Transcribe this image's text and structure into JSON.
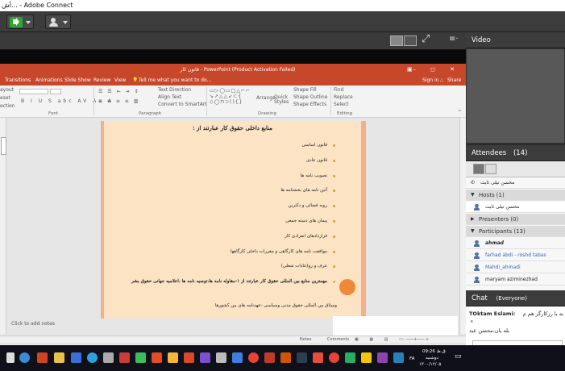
{
  "window": {
    "title": "أش... - Adobe Connect"
  },
  "toolbar": {
    "speaker_icon": "speaker-icon",
    "camera_icon": "camera-icon"
  },
  "share_pod": {
    "fullscreen_icon": "fullscreen-icon",
    "menu_glyph": "≡·"
  },
  "powerpoint": {
    "doc_title": "قانون کار  -  PowerPoint (Product Activation Failed)",
    "sign_in": "Sign in",
    "share": "Share",
    "tabs": [
      "Transitions",
      "Animations",
      "Slide Show",
      "Review",
      "View",
      "Tell me what you want to do..."
    ],
    "ribbon": {
      "groups": [
        "Font",
        "Paragraph",
        "Drawing",
        "Editing"
      ],
      "items": [
        "Text Direction",
        "Align Text",
        "Convert to SmartArt",
        "Arrange",
        "Quick Styles",
        "Shape Fill",
        "Shape Outline",
        "Shape Effects",
        "Find",
        "Replace",
        "Select"
      ],
      "left_items": [
        "ayout",
        "eset",
        "ection"
      ]
    },
    "slide": {
      "title": "منابع داخلی حقوق کار عبارتند از :",
      "bullets": [
        "قانون اساسی",
        "قانون عادی",
        "تصویب نامه ها",
        "آئین نامه های بخشنامه ها",
        "رویه قضائی و دکترین",
        "پیمان های دسته جمعی",
        "قراردادهای انفرادی کار",
        "موافقت نامه های کارگاهی و مقررات داخلی کارگاهها",
        "عرف و رو(عادات شغلی)",
        "مهمترین منابع بین المللی حقوق کار عبارتند از ۱-مقاوله نامه ها،توصیه نامه ها ،اعلامیه جهانی حقوق بشر"
      ],
      "tail": "ومیثاق بین المللی حقوق مدنی وسیاسی -عهدنامه های بین کشورها"
    },
    "notes_placeholder": "Click to add notes",
    "status": {
      "notes": "Notes",
      "comments": "Comments"
    }
  },
  "video_pod": {
    "title": "Video"
  },
  "attendees_pod": {
    "title": "Attendees",
    "count": "(14)",
    "top_user": "محسن نیلی ثابت",
    "hosts_label": "Hosts (1)",
    "hosts": [
      "محسن نیلی ثابت"
    ],
    "presenters_label": "Presenters (0)",
    "participants_label": "Participants (13)",
    "participants": [
      "ahmad",
      "farhad abdi - roshd tabas",
      "Mahdi_ahmadi",
      "maryam aziminezhad"
    ]
  },
  "chat_pod": {
    "title": "Chat",
    "scope": "(Everyone)",
    "messages": [
      {
        "author": "TOktam Eslami:",
        "text": "به با رزکارگر هم م",
        "text2": "ء"
      },
      {
        "author": "",
        "text": "بله بان،محسن عبد",
        "text2": ""
      }
    ]
  },
  "taskbar": {
    "time": "09:26 ق.ظ",
    "day": "دوشنبه",
    "date": "۱۴۰۰/۱۲/۰۵",
    "lang": "FA"
  }
}
